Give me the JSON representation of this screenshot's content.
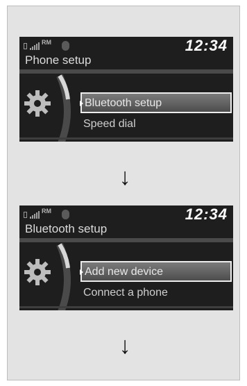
{
  "screens": [
    {
      "status": {
        "roaming": "RM",
        "battery_icon": "battery-icon",
        "signal_icon": "signal-icon",
        "bluetooth_icon": "bluetooth-icon"
      },
      "clock": "12:34",
      "title": "Phone setup",
      "items": [
        {
          "label": "Bluetooth setup",
          "selected": true
        },
        {
          "label": "Speed dial",
          "selected": false
        }
      ]
    },
    {
      "status": {
        "roaming": "RM",
        "battery_icon": "battery-icon",
        "signal_icon": "signal-icon",
        "bluetooth_icon": "bluetooth-icon"
      },
      "clock": "12:34",
      "title": "Bluetooth setup",
      "items": [
        {
          "label": "Add new device",
          "selected": true
        },
        {
          "label": "Connect a phone",
          "selected": false
        }
      ]
    }
  ],
  "arrows": [
    "↓",
    "↓"
  ],
  "colors": {
    "screen_bg": "#1e1e1e",
    "frame_bg": "#e3e3e3",
    "highlight": "#ededed"
  }
}
